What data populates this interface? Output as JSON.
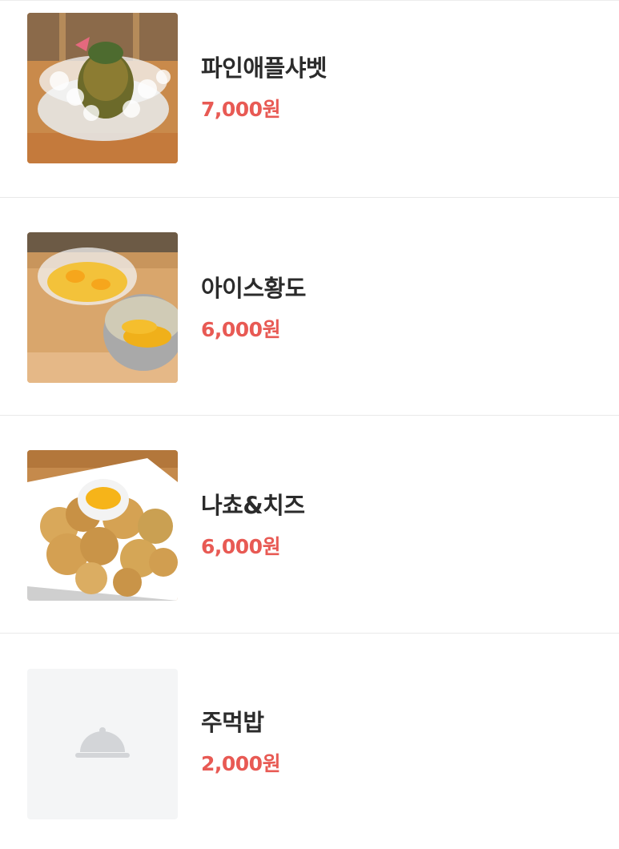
{
  "menu": {
    "items": [
      {
        "name": "파인애플샤벳",
        "price": "7,000원",
        "image": "pineapple-sherbet-photo"
      },
      {
        "name": "아이스황도",
        "price": "6,000원",
        "image": "iced-yellow-peach-photo"
      },
      {
        "name": "나쵸&치즈",
        "price": "6,000원",
        "image": "nachos-cheese-photo"
      },
      {
        "name": "주먹밥",
        "price": "2,000원",
        "image": "cloche-icon"
      }
    ]
  },
  "colors": {
    "price": "#e85a54",
    "name": "#2b2b2b",
    "placeholder_bg": "#f4f5f6",
    "placeholder_icon": "#d3d5d8"
  }
}
